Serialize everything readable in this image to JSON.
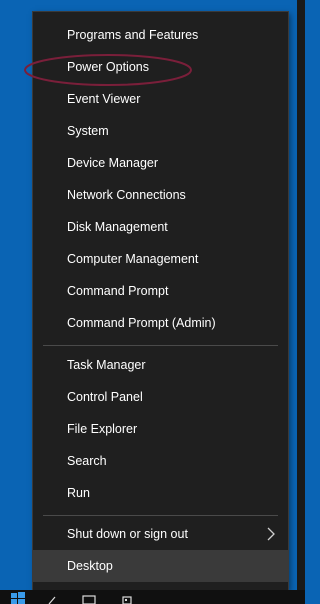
{
  "menu": {
    "group1": [
      {
        "label": "Programs and Features"
      },
      {
        "label": "Power Options"
      },
      {
        "label": "Event Viewer"
      },
      {
        "label": "System"
      },
      {
        "label": "Device Manager"
      },
      {
        "label": "Network Connections"
      },
      {
        "label": "Disk Management"
      },
      {
        "label": "Computer Management"
      },
      {
        "label": "Command Prompt"
      },
      {
        "label": "Command Prompt (Admin)"
      }
    ],
    "group2": [
      {
        "label": "Task Manager"
      },
      {
        "label": "Control Panel"
      },
      {
        "label": "File Explorer"
      },
      {
        "label": "Search"
      },
      {
        "label": "Run"
      }
    ],
    "group3": [
      {
        "label": "Shut down or sign out",
        "icon": "chevron-right-icon"
      },
      {
        "label": "Desktop"
      }
    ],
    "annotation_color": "#7a1f3a",
    "menu_bg": "#1f1f1f",
    "desktop_bg": "#0a64b4"
  },
  "taskbar": {
    "icons": [
      "windows-start-icon",
      "search-icon",
      "task-view-icon",
      "store-icon"
    ]
  }
}
